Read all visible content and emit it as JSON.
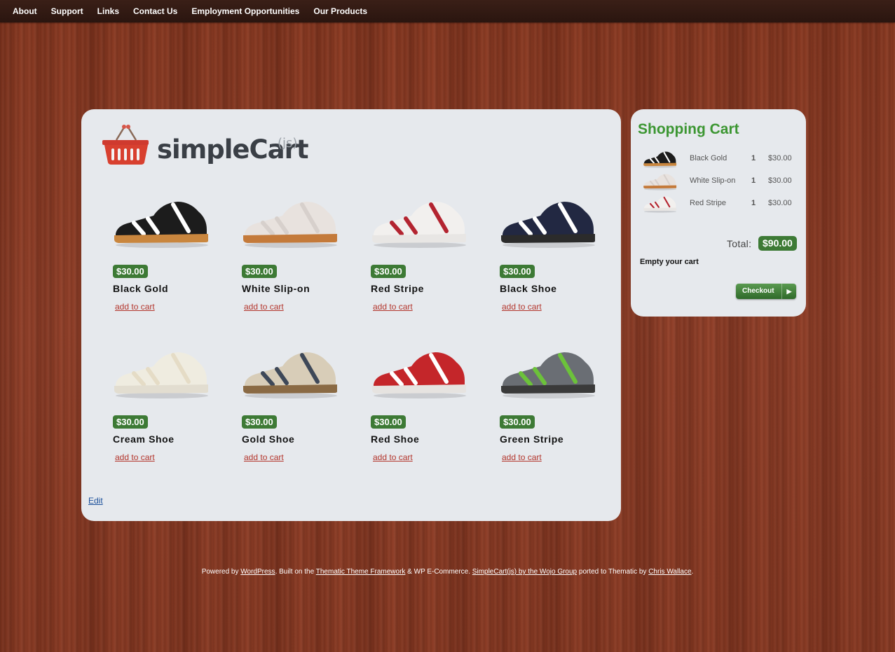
{
  "nav": {
    "items": [
      {
        "label": "About"
      },
      {
        "label": "Support"
      },
      {
        "label": "Links"
      },
      {
        "label": "Contact Us"
      },
      {
        "label": "Employment Opportunities"
      },
      {
        "label": "Our Products"
      }
    ]
  },
  "logo": {
    "wordmark": "simpleCart",
    "suffix": "(js)",
    "icon": "shopping-basket-icon"
  },
  "products": [
    {
      "name": "Black Gold",
      "price": "$30.00",
      "add_label": "add to cart",
      "colors": {
        "body": "#1c1c1c",
        "stripe": "#ffffff",
        "sole": "#c9863e"
      }
    },
    {
      "name": "White Slip-on",
      "price": "$30.00",
      "add_label": "add to cart",
      "colors": {
        "body": "#e8e2de",
        "stripe": "#d7d0cc",
        "sole": "#c47a3a"
      }
    },
    {
      "name": "Red Stripe",
      "price": "$30.00",
      "add_label": "add to cart",
      "colors": {
        "body": "#f2f0ee",
        "stripe": "#b32430",
        "sole": "#e8e6e4"
      }
    },
    {
      "name": "Black Shoe",
      "price": "$30.00",
      "add_label": "add to cart",
      "colors": {
        "body": "#222842",
        "stripe": "#ffffff",
        "sole": "#2b2b2b"
      }
    },
    {
      "name": "Cream Shoe",
      "price": "$30.00",
      "add_label": "add to cart",
      "colors": {
        "body": "#efece0",
        "stripe": "#e5dcc6",
        "sole": "#e2ddd0"
      }
    },
    {
      "name": "Gold Shoe",
      "price": "$30.00",
      "add_label": "add to cart",
      "colors": {
        "body": "#d8cdb8",
        "stripe": "#3e4858",
        "sole": "#8a6a44"
      }
    },
    {
      "name": "Red Shoe",
      "price": "$30.00",
      "add_label": "add to cart",
      "colors": {
        "body": "#c4262a",
        "stripe": "#ffffff",
        "sole": "#e6e3e0"
      }
    },
    {
      "name": "Green Stripe",
      "price": "$30.00",
      "add_label": "add to cart",
      "colors": {
        "body": "#6a6e74",
        "stripe": "#6cc23a",
        "sole": "#3a3a3a"
      }
    }
  ],
  "edit_label": "Edit",
  "cart": {
    "title": "Shopping Cart",
    "items": [
      {
        "name": "Black Gold",
        "qty": "1",
        "price": "$30.00"
      },
      {
        "name": "White Slip-on",
        "qty": "1",
        "price": "$30.00"
      },
      {
        "name": "Red Stripe",
        "qty": "1",
        "price": "$30.00"
      }
    ],
    "total_label": "Total:",
    "total_value": "$90.00",
    "empty_label": "Empty your cart",
    "checkout_label": "Checkout"
  },
  "footer": {
    "t1": "Powered by ",
    "l1": "WordPress",
    "t2": ". Built on the ",
    "l2": "Thematic Theme Framework",
    "t3": " & WP E-Commerce. ",
    "l3": "SimpleCart(js) by the Wojo Group",
    "t4": " ported to Thematic by ",
    "l4": "Chris Wallace",
    "t5": "."
  },
  "colors": {
    "accent_green": "#3d7a35",
    "title_green": "#3c9632",
    "link_red": "#b3362d",
    "panel_bg": "#e6e9ed",
    "nav_bg": "#2a150f"
  }
}
